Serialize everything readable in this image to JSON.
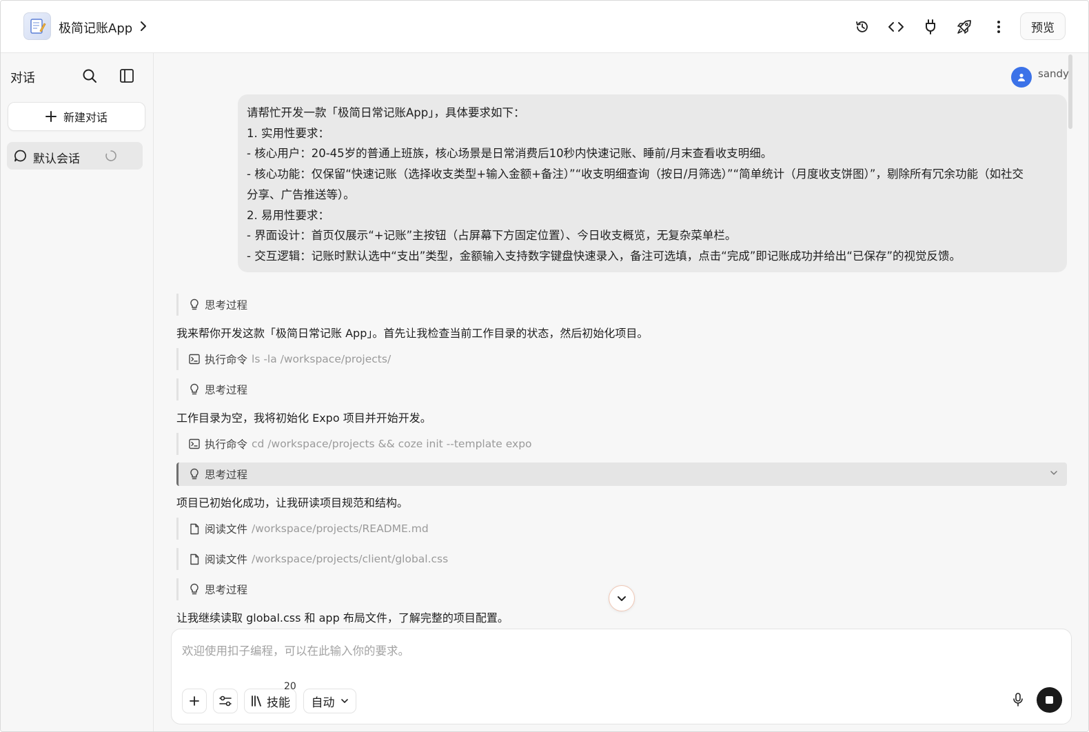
{
  "header": {
    "app_title": "极简记账App",
    "preview_label": "预览",
    "icons": [
      "history-icon",
      "code-icon",
      "plug-icon",
      "rocket-icon",
      "more-vertical-icon"
    ]
  },
  "sidebar": {
    "title": "对话",
    "new_chat_label": "新建对话",
    "sessions": [
      {
        "label": "默认会话",
        "loading": true
      }
    ]
  },
  "conversation": {
    "user": {
      "name": "sandy",
      "message_lines": [
        "请帮忙开发一款「极简日常记账App」，具体要求如下：",
        "1. 实用性要求：",
        "- 核心用户：20-45岁的普通上班族，核心场景是日常消费后10秒内快速记账、睡前/月末查看收支明细。",
        "- 核心功能：仅保留“快速记账（选择收支类型+输入金额+备注）”“收支明细查询（按日/月筛选）”“简单统计（月度收支饼图）”，剔除所有冗余功能（如社交",
        "分享、广告推送等）。",
        "2. 易用性要求：",
        "- 界面设计：首页仅展示“+记账”主按钮（占屏幕下方固定位置）、今日收支概览，无复杂菜单栏。",
        "- 交互逻辑：记账时默认选中“支出”类型，金额输入支持数字键盘快速录入，备注可选填，点击“完成”即记账成功并给出“已保存”的视觉反馈。"
      ]
    },
    "steps": [
      {
        "kind": "thinking",
        "label": "思考过程"
      },
      {
        "kind": "text",
        "text": "我来帮你开发这款「极简日常记账 App」。首先让我检查当前工作目录的状态，然后初始化项目。"
      },
      {
        "kind": "command",
        "label": "执行命令",
        "detail": "ls -la /workspace/projects/"
      },
      {
        "kind": "thinking",
        "label": "思考过程"
      },
      {
        "kind": "text",
        "text": "工作目录为空，我将初始化 Expo 项目并开始开发。"
      },
      {
        "kind": "command",
        "label": "执行命令",
        "detail": "cd /workspace/projects && coze init --template expo"
      },
      {
        "kind": "thinking",
        "label": "思考过程",
        "active": true
      },
      {
        "kind": "text",
        "text": "项目已初始化成功，让我研读项目规范和结构。"
      },
      {
        "kind": "file",
        "label": "阅读文件",
        "detail": "/workspace/projects/README.md"
      },
      {
        "kind": "file",
        "label": "阅读文件",
        "detail": "/workspace/projects/client/global.css"
      },
      {
        "kind": "thinking",
        "label": "思考过程"
      },
      {
        "kind": "text",
        "text": "让我继续读取 global.css 和 app 布局文件，了解完整的项目配置。"
      }
    ]
  },
  "composer": {
    "placeholder": "欢迎使用扣子编程，可以在此输入你的要求。",
    "skills_label": "技能",
    "skills_count": "20",
    "mode_label": "自动"
  },
  "colors": {
    "accent_blue": "#3b72e8",
    "stop_button": "#1a1a1a",
    "scroll_ring": "#f0c8b6"
  }
}
